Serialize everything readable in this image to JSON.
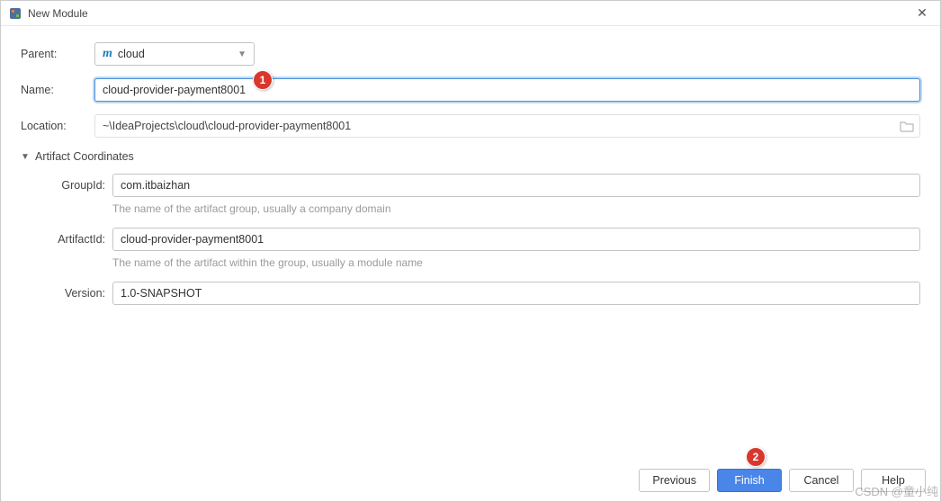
{
  "window": {
    "title": "New Module"
  },
  "form": {
    "parent_label": "Parent:",
    "parent_value": "cloud",
    "name_label": "Name:",
    "name_value": "cloud-provider-payment8001",
    "location_label": "Location:",
    "location_value": "~\\IdeaProjects\\cloud\\cloud-provider-payment8001"
  },
  "section": {
    "title": "Artifact Coordinates",
    "group_label": "GroupId:",
    "group_value": "com.itbaizhan",
    "group_help": "The name of the artifact group, usually a company domain",
    "artifact_label": "ArtifactId:",
    "artifact_value": "cloud-provider-payment8001",
    "artifact_help": "The name of the artifact within the group, usually a module name",
    "version_label": "Version:",
    "version_value": "1.0-SNAPSHOT"
  },
  "buttons": {
    "previous": "Previous",
    "finish": "Finish",
    "cancel": "Cancel",
    "help": "Help"
  },
  "annotations": {
    "badge1": "1",
    "badge2": "2"
  },
  "watermark": "CSDN @童小纯"
}
